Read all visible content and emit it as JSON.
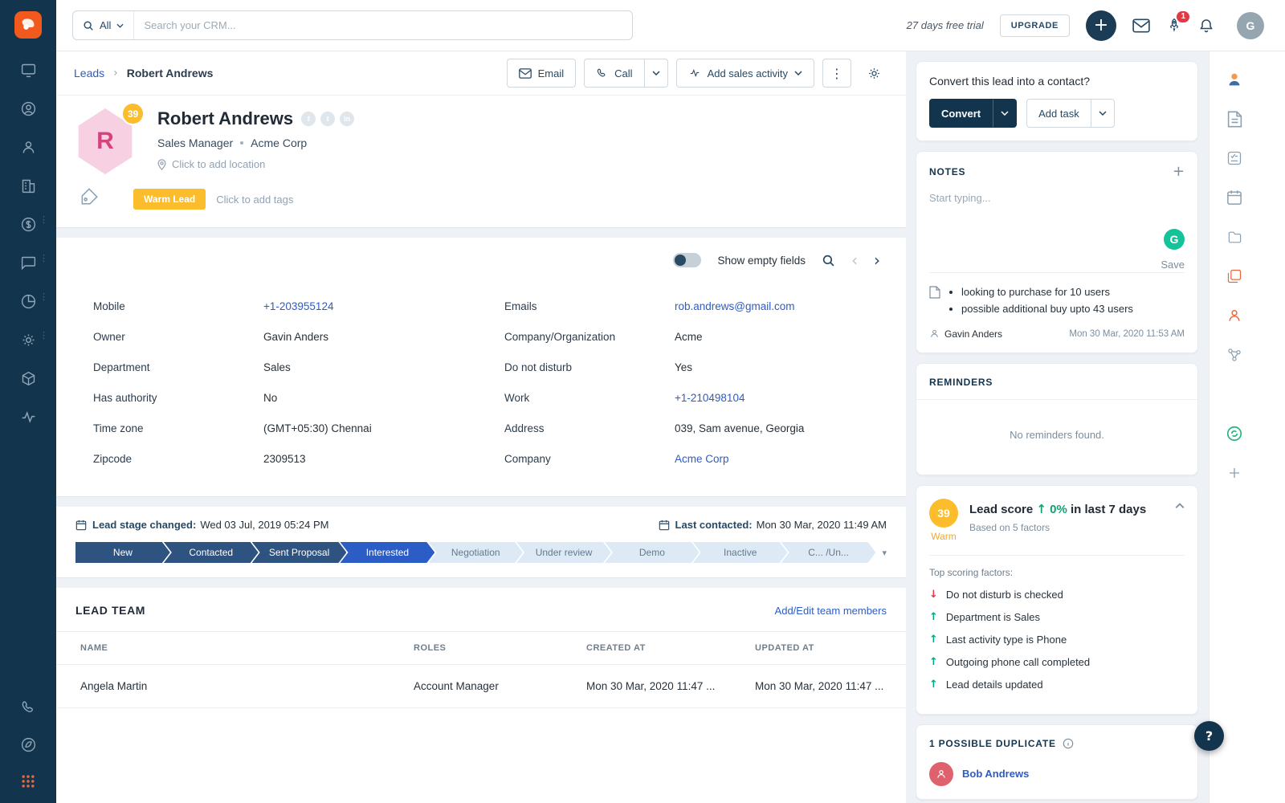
{
  "colors": {
    "accent_blue": "#2c5cc5",
    "navy": "#12344d",
    "warm_yellow": "#fbbd2c",
    "danger_red": "#e43845",
    "success_green": "#00a886",
    "logo_orange": "#f2591c"
  },
  "icons": {
    "plus": "+",
    "caret_down": "▾",
    "kebab": "⋮",
    "question": "?",
    "arrow_up": "↑",
    "arrow_down": "↓",
    "crumb_sep": "›",
    "chevron_left": "‹",
    "chevron_right": "›",
    "grammarly": "G"
  },
  "topbar": {
    "search_scope": "All",
    "search_placeholder": "Search your CRM...",
    "trial_text": "27 days free trial",
    "upgrade_label": "UPGRADE",
    "rocket_badge": "1",
    "avatar_initial": "G"
  },
  "breadcrumb": {
    "root": "Leads",
    "current": "Robert Andrews"
  },
  "actions": {
    "email": "Email",
    "call": "Call",
    "add_sales_activity": "Add sales activity"
  },
  "lead": {
    "score": "39",
    "initial": "R",
    "name": "Robert Andrews",
    "socials": {
      "facebook": "f",
      "twitter": "t",
      "linkedin": "in"
    },
    "subtitle_role": "Sales Manager",
    "subtitle_company": "Acme Corp",
    "location_placeholder": "Click to add location",
    "tag": "Warm Lead",
    "tags_placeholder": "Click to add tags"
  },
  "details": {
    "toggle_label": "Show empty fields",
    "left": [
      {
        "label": "Mobile",
        "value": "+1-203955124"
      },
      {
        "label": "Owner",
        "value": "Gavin Anders"
      },
      {
        "label": "Department",
        "value": "Sales"
      },
      {
        "label": "Has authority",
        "value": "No"
      },
      {
        "label": "Time zone",
        "value": "(GMT+05:30) Chennai"
      },
      {
        "label": "Zipcode",
        "value": "2309513"
      }
    ],
    "right": [
      {
        "label": "Emails",
        "value": "rob.andrews@gmail.com"
      },
      {
        "label": "Company/Organization",
        "value": "Acme"
      },
      {
        "label": "Do not disturb",
        "value": "Yes"
      },
      {
        "label": "Work",
        "value": "+1-210498104"
      },
      {
        "label": "Address",
        "value": "039, Sam avenue, Georgia"
      },
      {
        "label": "Company",
        "value": "Acme Corp"
      }
    ]
  },
  "stage": {
    "changed_label": "Lead stage changed:",
    "changed_value": "Wed 03 Jul, 2019 05:24 PM",
    "last_contacted_label": "Last contacted:",
    "last_contacted_value": "Mon 30 Mar, 2020 11:49 AM",
    "stages": [
      {
        "label": "New",
        "state": "done"
      },
      {
        "label": "Contacted",
        "state": "done"
      },
      {
        "label": "Sent Proposal",
        "state": "done"
      },
      {
        "label": "Interested",
        "state": "current"
      },
      {
        "label": "Negotiation",
        "state": "future"
      },
      {
        "label": "Under review",
        "state": "future"
      },
      {
        "label": "Demo",
        "state": "future"
      },
      {
        "label": "Inactive",
        "state": "future"
      },
      {
        "label": "C... /Un...",
        "state": "future"
      }
    ]
  },
  "lead_team": {
    "title": "LEAD TEAM",
    "add_link": "Add/Edit team members",
    "columns": [
      "NAME",
      "ROLES",
      "CREATED AT",
      "UPDATED AT"
    ],
    "rows": [
      [
        "Angela Martin",
        "Account Manager",
        "Mon 30 Mar, 2020 11:47 ...",
        "Mon 30 Mar, 2020 11:47 ..."
      ]
    ]
  },
  "convert": {
    "question": "Convert this lead into a contact?",
    "convert_label": "Convert",
    "add_task_label": "Add task"
  },
  "notes": {
    "title": "NOTES",
    "placeholder": "Start typing...",
    "save_label": "Save",
    "note_items": [
      "looking to purchase for 10 users",
      "possible additional buy upto 43 users"
    ],
    "note_author": "Gavin Anders",
    "note_time": "Mon 30 Mar, 2020 11:53 AM"
  },
  "reminders": {
    "title": "REMINDERS",
    "empty": "No reminders found."
  },
  "lead_score": {
    "score": "39",
    "badge_label": "Warm",
    "title": "Lead score",
    "trend_pct": "0%",
    "trend_rest": "in last 7 days",
    "subtitle": "Based on 5 factors",
    "factors_title": "Top scoring factors:",
    "factors": [
      {
        "text": "Do not disturb is checked",
        "direction": "down"
      },
      {
        "text": "Department is Sales",
        "direction": "up"
      },
      {
        "text": "Last activity type is Phone",
        "direction": "up"
      },
      {
        "text": "Outgoing phone call completed",
        "direction": "up"
      },
      {
        "text": "Lead details updated",
        "direction": "up"
      }
    ]
  },
  "duplicates": {
    "title": "1 POSSIBLE DUPLICATE",
    "name": "Bob Andrews"
  }
}
